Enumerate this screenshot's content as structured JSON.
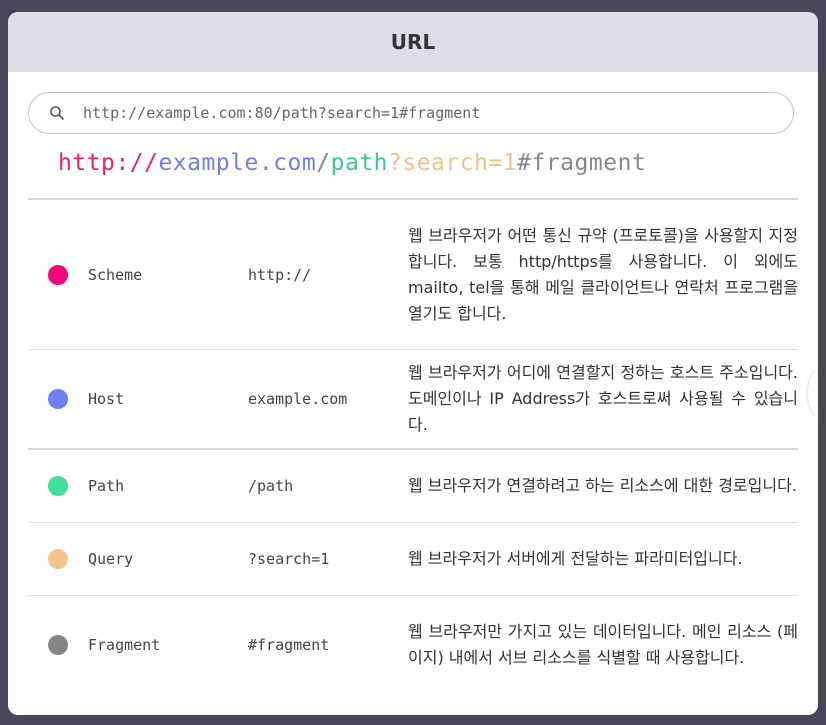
{
  "header": {
    "title": "URL"
  },
  "search": {
    "value": "http://example.com:80/path?search=1#fragment"
  },
  "colored_url": {
    "parts": [
      {
        "text": "http://",
        "color": "#e8206f"
      },
      {
        "text": "example.com",
        "color": "#6f7fe8"
      },
      {
        "text": "/",
        "color": "#8a8a8a"
      },
      {
        "text": "path",
        "color": "#3ec88c"
      },
      {
        "text": "?search=1",
        "color": "#f1c189"
      },
      {
        "text": "#fragment",
        "color": "#888888"
      }
    ]
  },
  "rows": [
    {
      "name": "Scheme",
      "value": "http://",
      "color": "#f0087a",
      "desc": "웹 브라우저가 어떤 통신 규약 (프로토콜)을 사용할지 지정합니다. 보통 http/https를 사용합니다. 이 외에도 mailto, tel을 통해 메일 클라이언트나 연락처 프로그램을 열기도 합니다."
    },
    {
      "name": "Host",
      "value": "example.com",
      "color": "#6f7ff0",
      "desc": "웹 브라우저가 어디에 연결할지 정하는 호스트 주소입니다. 도메인이나 IP Address가 호스트로써 사용될 수 있습니다."
    },
    {
      "name": "Path",
      "value": "/path",
      "color": "#3ee09a",
      "desc": "웹 브라우저가 연결하려고 하는 리소스에 대한 경로입니다."
    },
    {
      "name": "Query",
      "value": "?search=1",
      "color": "#f3c48c",
      "desc": "웹 브라우저가 서버에게 전달하는 파라미터입니다."
    },
    {
      "name": "Fragment",
      "value": "#fragment",
      "color": "#858585",
      "desc": "웹 브라우저만 가지고 있는 데이터입니다. 메인 리소스 (페이지) 내에서 서브 리소스를 식별할 때 사용합니다."
    }
  ]
}
